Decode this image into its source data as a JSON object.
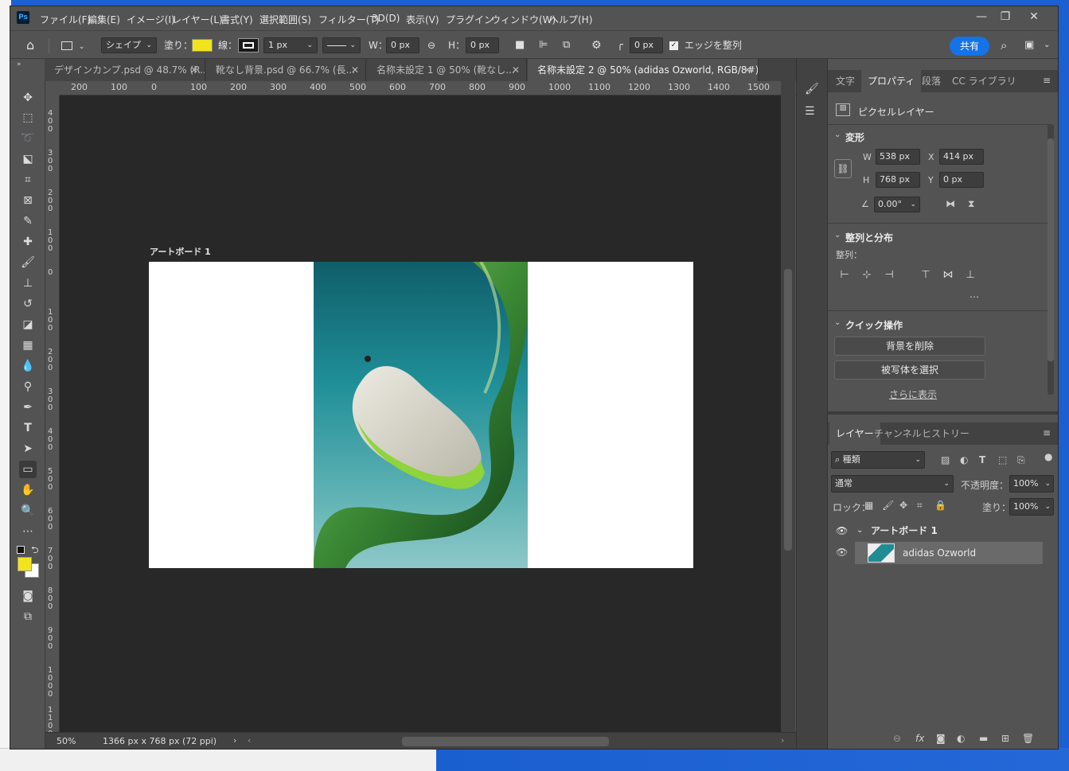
{
  "menu": {
    "items": [
      "ファイル(F)",
      "編集(E)",
      "イメージ(I)",
      "レイヤー(L)",
      "書式(Y)",
      "選択範囲(S)",
      "フィルター(T)",
      "3D(D)",
      "表示(V)",
      "プラグイン",
      "ウィンドウ(W)",
      "ヘルプ(H)"
    ],
    "logo": "Ps"
  },
  "options": {
    "shape_mode": "シェイプ",
    "fill_label": "塗り：",
    "fill_color": "#f2e41c",
    "stroke_label": "線：",
    "stroke_width": "1 px",
    "w_label": "W：",
    "w_value": "0 px",
    "h_label": "H：",
    "h_value": "0 px",
    "corner_value": "0 px",
    "align_edges": "エッジを整列",
    "share": "共有"
  },
  "tabs": [
    {
      "label": "デザインカンプ.psd @ 48.7% (R..."
    },
    {
      "label": "靴なし背景.psd @ 66.7% (長..."
    },
    {
      "label": "名称未設定 1 @ 50% (靴なし..."
    },
    {
      "label": "名称未設定 2 @ 50% (adidas Ozworld, RGB/8#) *"
    }
  ],
  "ruler_h": [
    "200",
    "100",
    "0",
    "100",
    "200",
    "300",
    "400",
    "500",
    "600",
    "700",
    "800",
    "900",
    "1000",
    "1100",
    "1200",
    "1300",
    "1400",
    "1500"
  ],
  "ruler_v": [
    "400",
    "300",
    "200",
    "100",
    "0",
    "100",
    "200",
    "300",
    "400",
    "500",
    "600",
    "700",
    "800",
    "900",
    "1000",
    "1100"
  ],
  "canvas": {
    "artboard_label": "アートボード 1"
  },
  "status": {
    "zoom": "50%",
    "doc_info": "1366 px x 768 px (72 ppi)"
  },
  "props": {
    "tabs": [
      "文字",
      "プロパティ",
      "段落",
      "CC ライブラリ"
    ],
    "layer_type": "ピクセルレイヤー",
    "transform_title": "変形",
    "w_label": "W",
    "w": "538 px",
    "x_label": "X",
    "x": "414 px",
    "h_label": "H",
    "h": "768 px",
    "y_label": "Y",
    "y": "0 px",
    "angle": "0.00°",
    "align_title": "整列と分布",
    "align_label": "整列：",
    "quick_title": "クイック操作",
    "remove_bg": "背景を削除",
    "select_subject": "被写体を選択",
    "more": "さらに表示"
  },
  "layers": {
    "tabs": [
      "レイヤー",
      "チャンネル",
      "ヒストリー"
    ],
    "filter_kind": "種類",
    "blend_mode": "通常",
    "opacity_label": "不透明度：",
    "opacity": "100%",
    "lock_label": "ロック：",
    "fill_label": "塗り：",
    "fill": "100%",
    "items": [
      {
        "name": "アートボード 1"
      },
      {
        "name": "adidas Ozworld"
      }
    ]
  }
}
